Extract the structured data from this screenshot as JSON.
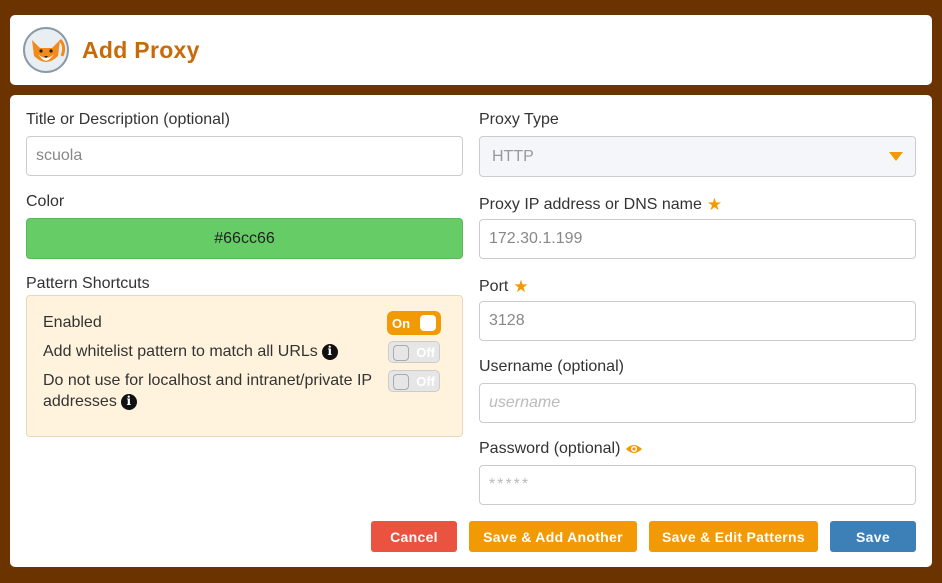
{
  "header": {
    "title": "Add Proxy"
  },
  "left": {
    "title_label": "Title or Description (optional)",
    "title_value": "scuola",
    "color_label": "Color",
    "color_value": "#66cc66",
    "shortcuts_label": "Pattern Shortcuts",
    "shortcuts": [
      {
        "label": "Enabled",
        "state": "On",
        "on": true
      },
      {
        "label": "Add whitelist pattern to match all URLs",
        "state": "Off",
        "on": false
      },
      {
        "label": "Do not use for localhost and intranet/private IP addresses",
        "state": "Off",
        "on": false
      }
    ]
  },
  "right": {
    "type_label": "Proxy Type",
    "type_value": "HTTP",
    "ip_label": "Proxy IP address or DNS name",
    "ip_value": "172.30.1.199",
    "port_label": "Port",
    "port_value": "3128",
    "user_label": "Username (optional)",
    "user_placeholder": "username",
    "pass_label": "Password (optional)",
    "pass_placeholder": "*****"
  },
  "buttons": {
    "cancel": "Cancel",
    "save_add_another": "Save & Add Another",
    "save_edit_patterns": "Save & Edit Patterns",
    "save": "Save"
  },
  "colors": {
    "brand": "#c86a08",
    "accent": "#f29a05",
    "danger": "#e9533f",
    "primary": "#3d80b8",
    "proxy_color": "#66cc66"
  },
  "icons": {
    "logo": "fox-logo-icon",
    "info": "info-icon",
    "required": "star-icon",
    "reveal": "eye-icon",
    "dropdown": "caret-down-icon"
  }
}
